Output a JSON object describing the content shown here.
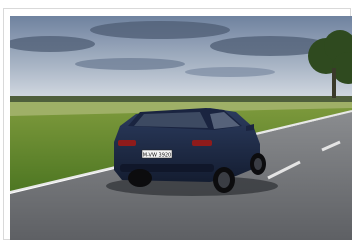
{
  "photo": {
    "subject": "dark-blue-station-wagon-on-road",
    "plate_text": "M-VW 3920",
    "colors": {
      "sky_top": "#7d8fa8",
      "sky_bottom": "#d7dde6",
      "grass": "#5f8a2c",
      "road": "#6f7276",
      "car_body": "#1f2d4a"
    }
  }
}
